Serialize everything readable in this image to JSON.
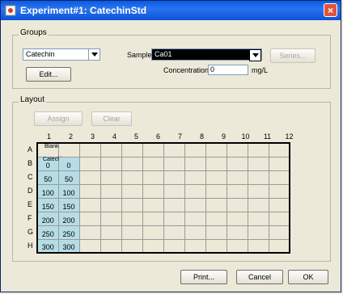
{
  "window": {
    "title": "Experiment#1: CatechinStd",
    "close": "×"
  },
  "groups": {
    "label": "Groups",
    "group_select": "Catechin",
    "edit_button": "Edit...",
    "sample_label": "Sample:",
    "sample_value": "Ca01",
    "series_button": "Series...",
    "concentration_label": "Concentration:",
    "concentration_value": "0",
    "concentration_unit": "mg/L"
  },
  "layout": {
    "label": "Layout",
    "assign_button": "Assign",
    "clear_button": "Clear",
    "columns": [
      "1",
      "2",
      "3",
      "4",
      "5",
      "6",
      "7",
      "8",
      "9",
      "10",
      "11",
      "12"
    ],
    "rows": [
      "A",
      "B",
      "C",
      "D",
      "E",
      "F",
      "G",
      "H"
    ],
    "blank_label": "Blank",
    "group_label": "Catechin",
    "values": {
      "B": [
        "0",
        "0"
      ],
      "C": [
        "50",
        "50"
      ],
      "D": [
        "100",
        "100"
      ],
      "E": [
        "150",
        "150"
      ],
      "F": [
        "200",
        "200"
      ],
      "G": [
        "250",
        "250"
      ],
      "H": [
        "300",
        "300"
      ]
    }
  },
  "footer": {
    "print_button": "Print...",
    "cancel_button": "Cancel",
    "ok_button": "OK"
  },
  "colors": {
    "filled_well": "#b6dde6",
    "titlebar": "#0a5be0"
  }
}
